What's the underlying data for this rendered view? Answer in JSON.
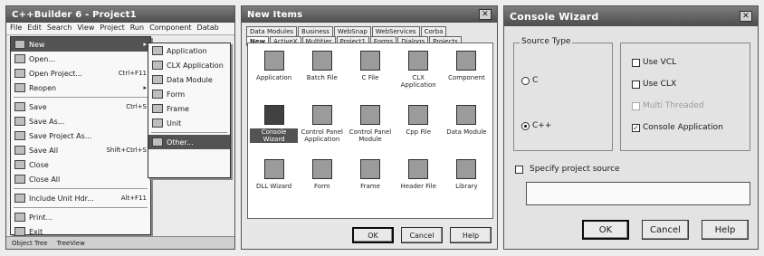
{
  "panel1": {
    "title": "C++Builder 6 - Project1",
    "menubar": [
      "File",
      "Edit",
      "Search",
      "View",
      "Project",
      "Run",
      "Component",
      "Datab"
    ],
    "file_menu": [
      {
        "label": "New",
        "shortcut": "",
        "selected": true,
        "arrow": true
      },
      {
        "label": "Open...",
        "shortcut": ""
      },
      {
        "label": "Open Project...",
        "shortcut": "Ctrl+F11"
      },
      {
        "label": "Reopen",
        "shortcut": "",
        "arrow": true
      },
      {
        "sep": true
      },
      {
        "label": "Save",
        "shortcut": "Ctrl+S"
      },
      {
        "label": "Save As...",
        "shortcut": ""
      },
      {
        "label": "Save Project As...",
        "shortcut": ""
      },
      {
        "label": "Save All",
        "shortcut": "Shift+Ctrl+S"
      },
      {
        "label": "Close",
        "shortcut": ""
      },
      {
        "label": "Close All",
        "shortcut": ""
      },
      {
        "sep": true
      },
      {
        "label": "Include Unit Hdr...",
        "shortcut": "Alt+F11"
      },
      {
        "sep": true
      },
      {
        "label": "Print...",
        "shortcut": ""
      },
      {
        "label": "Exit",
        "shortcut": ""
      }
    ],
    "sub_menu": [
      {
        "label": "Application"
      },
      {
        "label": "CLX Application"
      },
      {
        "label": "Data Module"
      },
      {
        "label": "Form"
      },
      {
        "label": "Frame"
      },
      {
        "label": "Unit"
      },
      {
        "sep": true
      },
      {
        "label": "Other...",
        "selected": true
      }
    ],
    "status": [
      "Object Tree",
      "TreeView"
    ]
  },
  "panel2": {
    "title": "New Items",
    "tabs_row1": [
      "Data Modules",
      "Business",
      "WebSnap",
      "WebServices",
      "Corba"
    ],
    "tabs_row2": [
      "New",
      "ActiveX",
      "Multitier",
      "Project1",
      "Forms",
      "Dialogs",
      "Projects"
    ],
    "active_tab": "New",
    "items": [
      {
        "label": "Application"
      },
      {
        "label": "Batch File"
      },
      {
        "label": "C File"
      },
      {
        "label": "CLX Application"
      },
      {
        "label": "Component"
      },
      {
        "label": "Console Wizard",
        "selected": true
      },
      {
        "label": "Control Panel Application"
      },
      {
        "label": "Control Panel Module"
      },
      {
        "label": "Cpp File"
      },
      {
        "label": "Data Module"
      },
      {
        "label": "DLL Wizard"
      },
      {
        "label": "Form"
      },
      {
        "label": "Frame"
      },
      {
        "label": "Header File"
      },
      {
        "label": "Library"
      }
    ],
    "buttons": {
      "ok": "OK",
      "cancel": "Cancel",
      "help": "Help"
    }
  },
  "panel3": {
    "title": "Console Wizard",
    "source_type_label": "Source Type",
    "radio_c": "C",
    "radio_cpp": "C++",
    "selected_source": "C++",
    "chk_vcl": "Use VCL",
    "chk_clx": "Use CLX",
    "chk_multithreaded": "Multi Threaded",
    "chk_console": "Console Application",
    "specify_source": "Specify project source",
    "buttons": {
      "ok": "OK",
      "cancel": "Cancel",
      "help": "Help"
    }
  }
}
